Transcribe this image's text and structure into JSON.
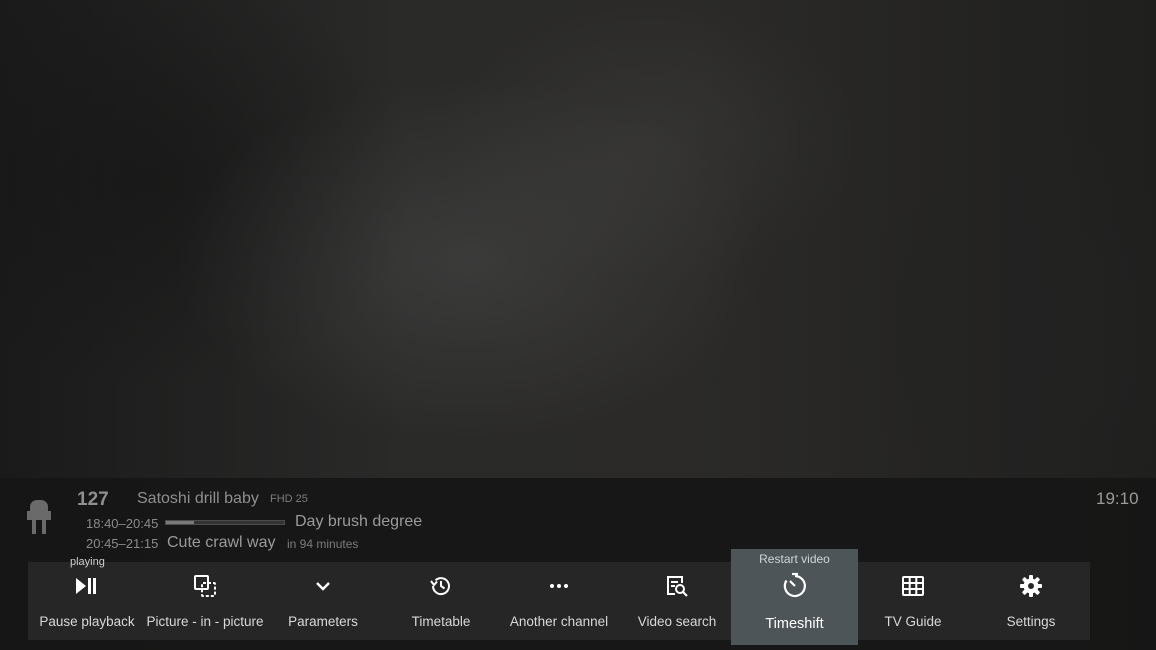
{
  "channel": {
    "number": "127",
    "name": "Satoshi drill baby",
    "quality": "FHD 25",
    "logo_icon": "plug-icon"
  },
  "clock": "19:10",
  "now": {
    "time": "18:40–20:45",
    "title": "Day brush degree",
    "progress": 0.24
  },
  "next": {
    "time": "20:45–21:15",
    "title": "Cute crawl way",
    "starts_in": "in 94 minutes"
  },
  "toolbar": {
    "status": "playing",
    "buttons": [
      {
        "label": "Pause playback",
        "icon": "play-pause-icon"
      },
      {
        "label": "Picture - in - picture",
        "icon": "pip-icon"
      },
      {
        "label": "Parameters",
        "icon": "chevron-down-icon"
      },
      {
        "label": "Timetable",
        "icon": "history-icon"
      },
      {
        "label": "Another channel",
        "icon": "more-horizontal-icon"
      },
      {
        "label": "Video search",
        "icon": "search-document-icon"
      },
      {
        "label": "Timeshift",
        "icon": "timer-restart-icon",
        "sublabel": "Restart video",
        "active": true
      },
      {
        "label": "TV Guide",
        "icon": "grid-icon"
      },
      {
        "label": "Settings",
        "icon": "gear-icon"
      }
    ]
  },
  "colors": {
    "panel_bg": "#161616",
    "toolbar_bg": "#262626",
    "active_bg": "#4d5558",
    "text": "#d8d8d8"
  }
}
